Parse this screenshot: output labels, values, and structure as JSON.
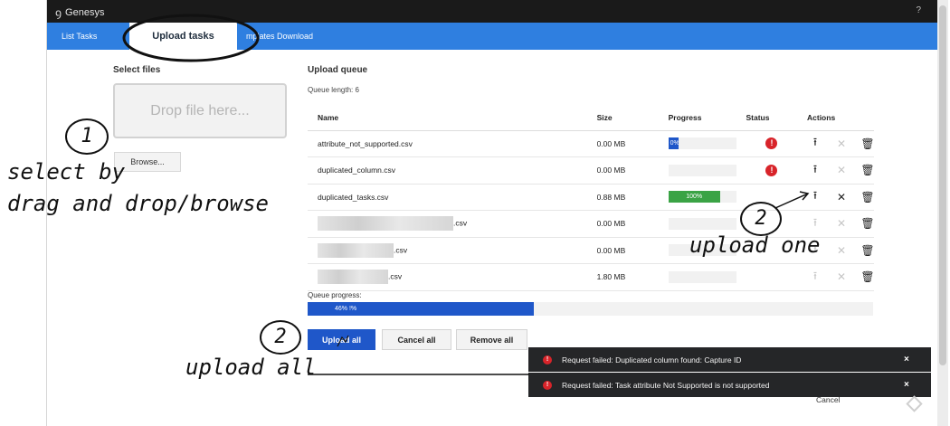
{
  "app": {
    "brand": "Genesys",
    "help": "?"
  },
  "tabs": [
    {
      "label": "List Tasks"
    },
    {
      "label": "Upload tasks"
    },
    {
      "label": "mplates Download"
    }
  ],
  "select_panel": {
    "title": "Select files",
    "dropzone": "Drop file here...",
    "browse": "Browse..."
  },
  "queue": {
    "title": "Upload queue",
    "length_label": "Queue length: 6",
    "headers": {
      "name": "Name",
      "size": "Size",
      "progress": "Progress",
      "status": "Status",
      "actions": "Actions"
    },
    "rows": [
      {
        "name": "attribute_not_supported.csv",
        "size": "0.00 MB",
        "progress_label": "0%",
        "progress": 0,
        "status": "error"
      },
      {
        "name": "duplicated_column.csv",
        "size": "0.00 MB",
        "progress_label": "",
        "progress": 0,
        "status": "error"
      },
      {
        "name": "duplicated_tasks.csv",
        "size": "0.88 MB",
        "progress_label": "100%",
        "progress": 1,
        "status": ""
      },
      {
        "name": ".csv",
        "size": "0.00 MB",
        "progress_label": "",
        "progress": 0,
        "status": ""
      },
      {
        "name": ".csv",
        "size": "0.00 MB",
        "progress_label": "",
        "progress": 0,
        "status": ""
      },
      {
        "name": ".csv",
        "size": "1.80 MB",
        "progress_label": "",
        "progress": 0,
        "status": ""
      }
    ],
    "progress_label": "Queue progress:",
    "progress_text": "46% !%",
    "progress_value": 0.4
  },
  "buttons": {
    "upload_all": "Upload all",
    "cancel_all": "Cancel all",
    "remove_all": "Remove all",
    "cancel": "Cancel"
  },
  "toasts": [
    {
      "text": "Request failed: Duplicated column found: Capture ID",
      "close": "×"
    },
    {
      "text": "Request failed: Task attribute Not Supported is not supported",
      "close": "×"
    }
  ],
  "annotations": {
    "step1": "1",
    "select_line1": "select by",
    "select_line2": "drag and drop/browse",
    "step2a": "2",
    "upload_one": "upload one",
    "step2b": "2",
    "upload_all": "upload all"
  },
  "icons": {
    "status_error": "!",
    "upload": "upload-arrow-icon",
    "cancel": "close-x-icon",
    "delete": "trash-icon"
  },
  "colors": {
    "tab_bar": "#2f7fe0",
    "primary": "#1f57c9",
    "success": "#3aa345",
    "error": "#d8242a"
  }
}
